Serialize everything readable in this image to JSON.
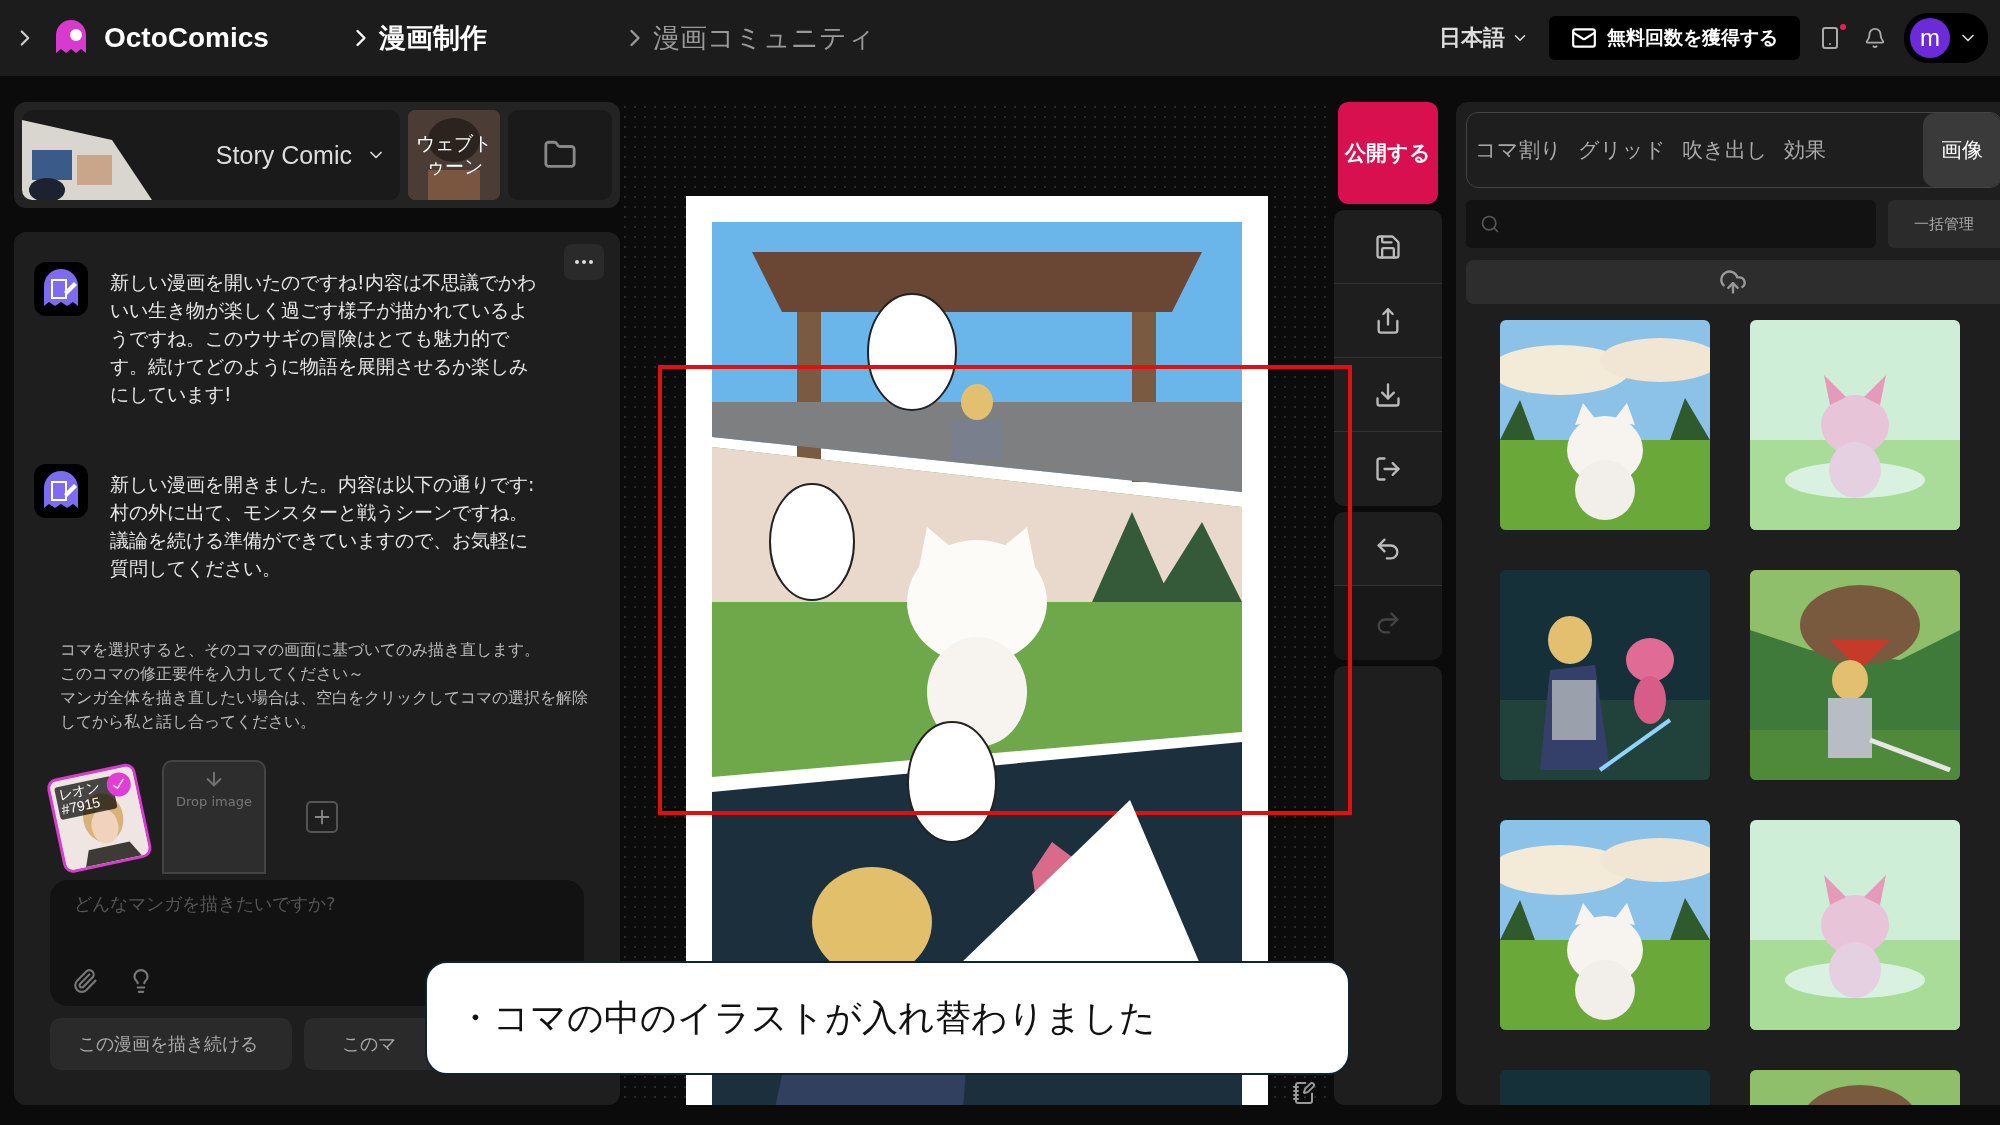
{
  "topbar": {
    "brand": "OctoComics",
    "nav": [
      {
        "label": "漫画制作",
        "selected": true
      },
      {
        "label": "漫画コミュニティ",
        "selected": false
      }
    ],
    "language": "日本語",
    "promo_button": "無料回数を獲得する",
    "has_notification": true,
    "avatar_letter": "m"
  },
  "style_picker": {
    "style": "Story Comic",
    "webtoon": "ウェブトゥーン"
  },
  "chat": {
    "messages": [
      "新しい漫画を開いたのですね!内容は不思議でかわいい生き物が楽しく過ごす様子が描かれているようですね。このウサギの冒険はとても魅力的です。続けてどのように物語を展開させるか楽しみにしています!",
      "新しい漫画を開きました。内容は以下の通りです: 村の外に出て、モンスターと戦うシーンですね。議論を続ける準備ができていますので、お気軽に質問してください。"
    ],
    "hint": [
      "コマを選択すると、そのコマの画面に基づいてのみ描き直します。",
      "このコマの修正要件を入力してください～",
      "マンガ全体を描き直したい場合は、空白をクリックしてコマの選択を解除してから私と話し合ってください。"
    ],
    "references": [
      {
        "kind": "character",
        "label": "レオン#7915",
        "selected": true
      },
      {
        "kind": "drop",
        "label": "Drop image",
        "selected": false
      }
    ],
    "input": {
      "placeholder": "どんなマンガを描きたいですか?"
    },
    "buttons": [
      "この漫画を描き続ける",
      "このマ"
    ]
  },
  "tools": [
    {
      "kind": "publish",
      "label": "公開する",
      "disabled": false
    },
    {
      "kind": "save",
      "disabled": false
    },
    {
      "kind": "share",
      "disabled": false
    },
    {
      "kind": "download",
      "disabled": false
    },
    {
      "kind": "exit",
      "disabled": false
    },
    {
      "kind": "undo",
      "disabled": false
    },
    {
      "kind": "redo",
      "disabled": true
    }
  ],
  "assets": {
    "tabs": [
      {
        "label": "コマ割り",
        "selected": false
      },
      {
        "label": "グリッド",
        "selected": false
      },
      {
        "label": "吹き出し",
        "selected": false
      },
      {
        "label": "効果",
        "selected": false
      },
      {
        "label": "画像",
        "selected": true
      }
    ],
    "manage_button": "一括管理"
  },
  "annotation": {
    "callout": "・コマの中のイラストが入れ替わりました"
  }
}
